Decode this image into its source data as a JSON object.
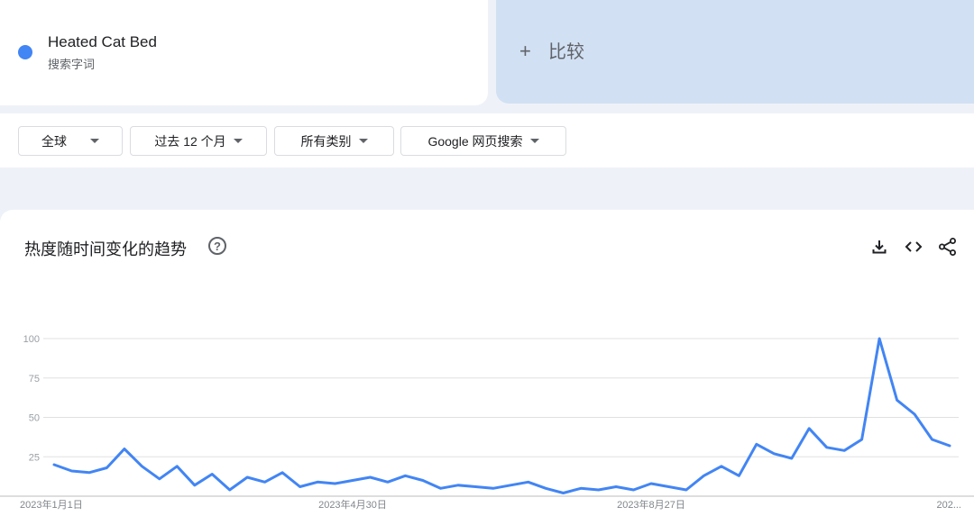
{
  "search_term": {
    "name": "Heated Cat Bed",
    "type_label": "搜索字词",
    "color": "#4285f4"
  },
  "compare": {
    "plus": "+",
    "label": "比较"
  },
  "filters": {
    "region": "全球",
    "time_range": "过去 12 个月",
    "category": "所有类别",
    "search_type": "Google 网页搜索"
  },
  "chart_card": {
    "title": "热度随时间变化的趋势",
    "help_glyph": "?",
    "icons": [
      "download-icon",
      "embed-icon",
      "share-icon"
    ]
  },
  "chart_data": {
    "type": "line",
    "title": "热度随时间变化的趋势",
    "xlabel": "",
    "ylabel": "",
    "ylim": [
      0,
      100
    ],
    "yticks": [
      25,
      50,
      75,
      100
    ],
    "x_tick_labels": [
      {
        "index": 0,
        "label": "2023年1月1日"
      },
      {
        "index": 17,
        "label": "2023年4月30日"
      },
      {
        "index": 34,
        "label": "2023年8月27日"
      },
      {
        "index": 51,
        "label": "202..."
      }
    ],
    "grid": true,
    "legend": "none",
    "series": [
      {
        "color": "#4285f4",
        "values": [
          20,
          16,
          15,
          18,
          30,
          19,
          11,
          19,
          7,
          14,
          4,
          12,
          9,
          15,
          6,
          9,
          8,
          10,
          12,
          9,
          13,
          10,
          5,
          7,
          6,
          5,
          7,
          9,
          5,
          2,
          5,
          4,
          6,
          4,
          8,
          6,
          4,
          13,
          19,
          13,
          33,
          27,
          24,
          43,
          31,
          29,
          36,
          100,
          61,
          52,
          36,
          32
        ]
      }
    ]
  }
}
